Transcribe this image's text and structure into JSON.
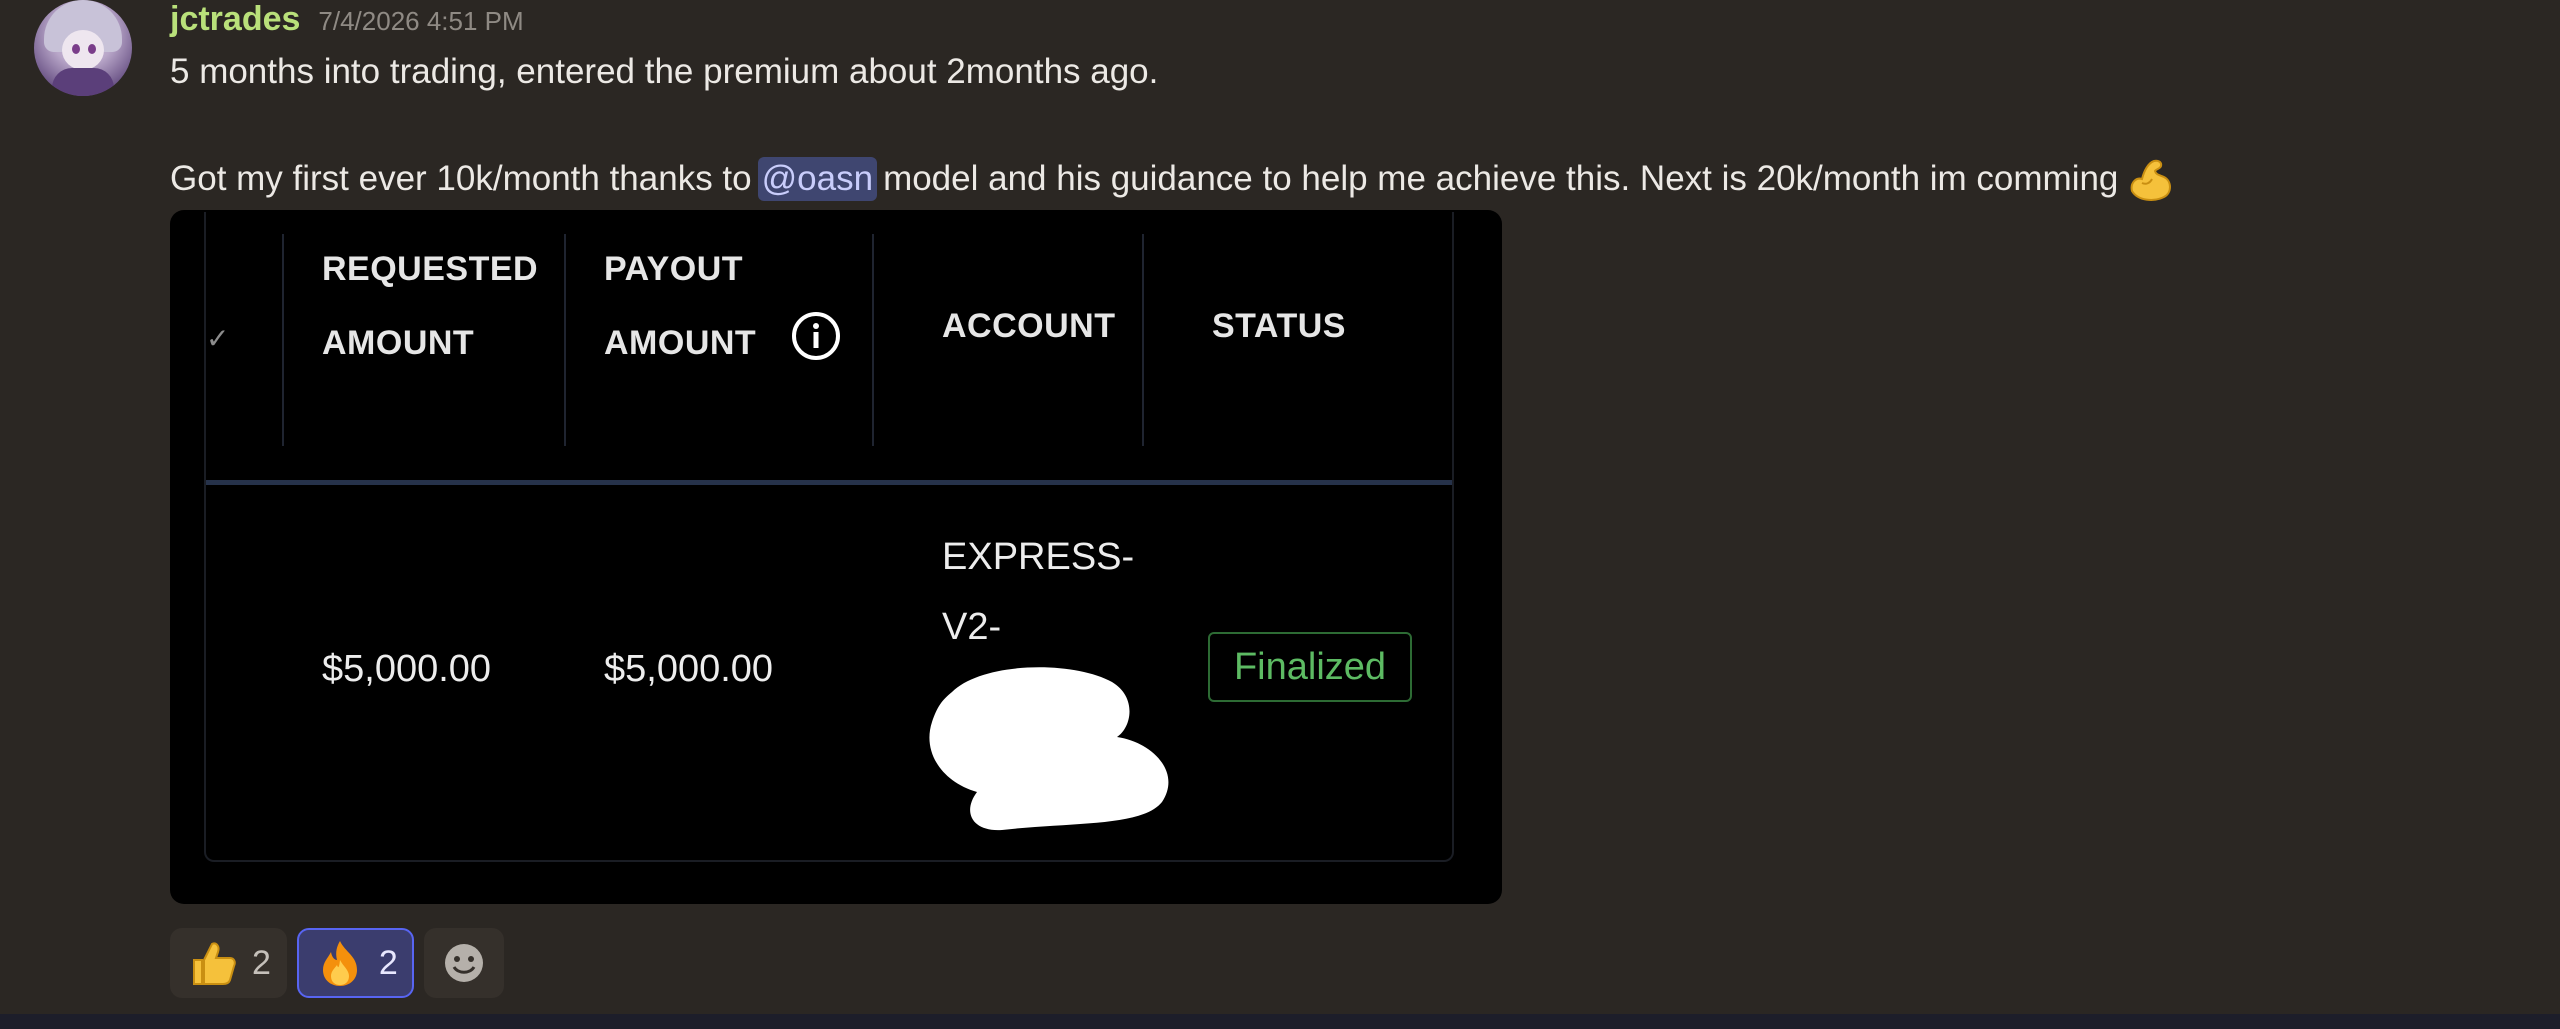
{
  "message": {
    "username": "jctrades",
    "timestamp": "7/4/2026 4:51 PM",
    "line1": "5 months into trading, entered the premium about 2months ago.",
    "line2_before": "Got my first ever 10k/month thanks to",
    "mention": "@oasn",
    "line2_after": "model and his guidance to help me achieve this. Next is 20k/month im comming",
    "trailing_emoji": "flexed-biceps-icon"
  },
  "embed": {
    "headers": {
      "requested_line1": "REQUESTED",
      "requested_line2": "AMOUNT",
      "payout_line1": "PAYOUT",
      "payout_line2": "AMOUNT",
      "account": "ACCOUNT",
      "status": "STATUS"
    },
    "row": {
      "requested_amount": "$5,000.00",
      "payout_amount": "$5,000.00",
      "account_line1": "EXPRESS-",
      "account_line2": "V2-",
      "status": "Finalized"
    },
    "colors": {
      "status_text": "#5dbb63",
      "status_border": "#2d6b34",
      "header_divider": "#26324a"
    }
  },
  "reactions": [
    {
      "icon": "thumbs-up-icon",
      "count": "2",
      "active": false
    },
    {
      "icon": "fire-icon",
      "count": "2",
      "active": true
    },
    {
      "icon": "add-reaction-icon",
      "count": "",
      "active": false
    }
  ],
  "colors": {
    "background": "#2b2723",
    "username": "#b9e07a",
    "mention_bg": "#3f4670",
    "mention_text": "#c9cdfb",
    "active_reaction_border": "#5865f2"
  }
}
